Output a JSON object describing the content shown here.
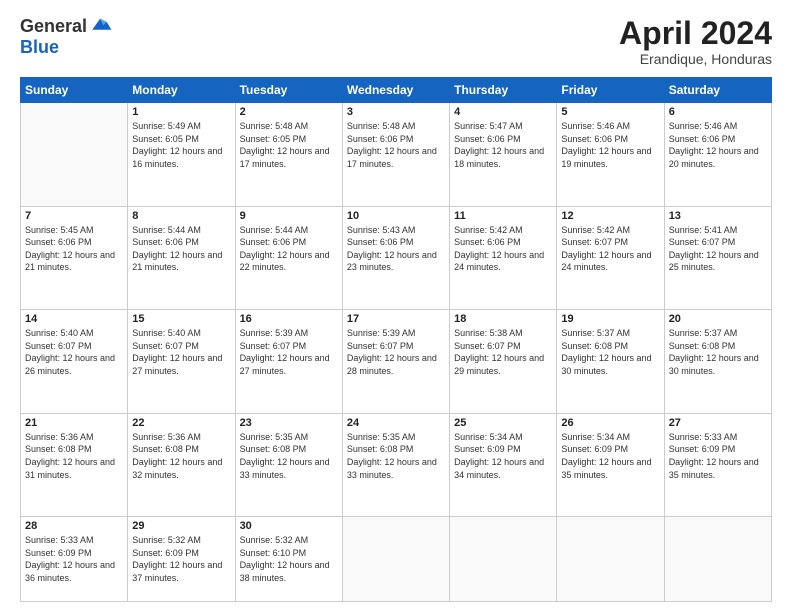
{
  "header": {
    "logo_general": "General",
    "logo_blue": "Blue",
    "month_title": "April 2024",
    "location": "Erandique, Honduras"
  },
  "weekdays": [
    "Sunday",
    "Monday",
    "Tuesday",
    "Wednesday",
    "Thursday",
    "Friday",
    "Saturday"
  ],
  "weeks": [
    [
      {
        "day": "",
        "sunrise": "",
        "sunset": "",
        "daylight": ""
      },
      {
        "day": "1",
        "sunrise": "Sunrise: 5:49 AM",
        "sunset": "Sunset: 6:05 PM",
        "daylight": "Daylight: 12 hours and 16 minutes."
      },
      {
        "day": "2",
        "sunrise": "Sunrise: 5:48 AM",
        "sunset": "Sunset: 6:05 PM",
        "daylight": "Daylight: 12 hours and 17 minutes."
      },
      {
        "day": "3",
        "sunrise": "Sunrise: 5:48 AM",
        "sunset": "Sunset: 6:06 PM",
        "daylight": "Daylight: 12 hours and 17 minutes."
      },
      {
        "day": "4",
        "sunrise": "Sunrise: 5:47 AM",
        "sunset": "Sunset: 6:06 PM",
        "daylight": "Daylight: 12 hours and 18 minutes."
      },
      {
        "day": "5",
        "sunrise": "Sunrise: 5:46 AM",
        "sunset": "Sunset: 6:06 PM",
        "daylight": "Daylight: 12 hours and 19 minutes."
      },
      {
        "day": "6",
        "sunrise": "Sunrise: 5:46 AM",
        "sunset": "Sunset: 6:06 PM",
        "daylight": "Daylight: 12 hours and 20 minutes."
      }
    ],
    [
      {
        "day": "7",
        "sunrise": "Sunrise: 5:45 AM",
        "sunset": "Sunset: 6:06 PM",
        "daylight": "Daylight: 12 hours and 21 minutes."
      },
      {
        "day": "8",
        "sunrise": "Sunrise: 5:44 AM",
        "sunset": "Sunset: 6:06 PM",
        "daylight": "Daylight: 12 hours and 21 minutes."
      },
      {
        "day": "9",
        "sunrise": "Sunrise: 5:44 AM",
        "sunset": "Sunset: 6:06 PM",
        "daylight": "Daylight: 12 hours and 22 minutes."
      },
      {
        "day": "10",
        "sunrise": "Sunrise: 5:43 AM",
        "sunset": "Sunset: 6:06 PM",
        "daylight": "Daylight: 12 hours and 23 minutes."
      },
      {
        "day": "11",
        "sunrise": "Sunrise: 5:42 AM",
        "sunset": "Sunset: 6:06 PM",
        "daylight": "Daylight: 12 hours and 24 minutes."
      },
      {
        "day": "12",
        "sunrise": "Sunrise: 5:42 AM",
        "sunset": "Sunset: 6:07 PM",
        "daylight": "Daylight: 12 hours and 24 minutes."
      },
      {
        "day": "13",
        "sunrise": "Sunrise: 5:41 AM",
        "sunset": "Sunset: 6:07 PM",
        "daylight": "Daylight: 12 hours and 25 minutes."
      }
    ],
    [
      {
        "day": "14",
        "sunrise": "Sunrise: 5:40 AM",
        "sunset": "Sunset: 6:07 PM",
        "daylight": "Daylight: 12 hours and 26 minutes."
      },
      {
        "day": "15",
        "sunrise": "Sunrise: 5:40 AM",
        "sunset": "Sunset: 6:07 PM",
        "daylight": "Daylight: 12 hours and 27 minutes."
      },
      {
        "day": "16",
        "sunrise": "Sunrise: 5:39 AM",
        "sunset": "Sunset: 6:07 PM",
        "daylight": "Daylight: 12 hours and 27 minutes."
      },
      {
        "day": "17",
        "sunrise": "Sunrise: 5:39 AM",
        "sunset": "Sunset: 6:07 PM",
        "daylight": "Daylight: 12 hours and 28 minutes."
      },
      {
        "day": "18",
        "sunrise": "Sunrise: 5:38 AM",
        "sunset": "Sunset: 6:07 PM",
        "daylight": "Daylight: 12 hours and 29 minutes."
      },
      {
        "day": "19",
        "sunrise": "Sunrise: 5:37 AM",
        "sunset": "Sunset: 6:08 PM",
        "daylight": "Daylight: 12 hours and 30 minutes."
      },
      {
        "day": "20",
        "sunrise": "Sunrise: 5:37 AM",
        "sunset": "Sunset: 6:08 PM",
        "daylight": "Daylight: 12 hours and 30 minutes."
      }
    ],
    [
      {
        "day": "21",
        "sunrise": "Sunrise: 5:36 AM",
        "sunset": "Sunset: 6:08 PM",
        "daylight": "Daylight: 12 hours and 31 minutes."
      },
      {
        "day": "22",
        "sunrise": "Sunrise: 5:36 AM",
        "sunset": "Sunset: 6:08 PM",
        "daylight": "Daylight: 12 hours and 32 minutes."
      },
      {
        "day": "23",
        "sunrise": "Sunrise: 5:35 AM",
        "sunset": "Sunset: 6:08 PM",
        "daylight": "Daylight: 12 hours and 33 minutes."
      },
      {
        "day": "24",
        "sunrise": "Sunrise: 5:35 AM",
        "sunset": "Sunset: 6:08 PM",
        "daylight": "Daylight: 12 hours and 33 minutes."
      },
      {
        "day": "25",
        "sunrise": "Sunrise: 5:34 AM",
        "sunset": "Sunset: 6:09 PM",
        "daylight": "Daylight: 12 hours and 34 minutes."
      },
      {
        "day": "26",
        "sunrise": "Sunrise: 5:34 AM",
        "sunset": "Sunset: 6:09 PM",
        "daylight": "Daylight: 12 hours and 35 minutes."
      },
      {
        "day": "27",
        "sunrise": "Sunrise: 5:33 AM",
        "sunset": "Sunset: 6:09 PM",
        "daylight": "Daylight: 12 hours and 35 minutes."
      }
    ],
    [
      {
        "day": "28",
        "sunrise": "Sunrise: 5:33 AM",
        "sunset": "Sunset: 6:09 PM",
        "daylight": "Daylight: 12 hours and 36 minutes."
      },
      {
        "day": "29",
        "sunrise": "Sunrise: 5:32 AM",
        "sunset": "Sunset: 6:09 PM",
        "daylight": "Daylight: 12 hours and 37 minutes."
      },
      {
        "day": "30",
        "sunrise": "Sunrise: 5:32 AM",
        "sunset": "Sunset: 6:10 PM",
        "daylight": "Daylight: 12 hours and 38 minutes."
      },
      {
        "day": "",
        "sunrise": "",
        "sunset": "",
        "daylight": ""
      },
      {
        "day": "",
        "sunrise": "",
        "sunset": "",
        "daylight": ""
      },
      {
        "day": "",
        "sunrise": "",
        "sunset": "",
        "daylight": ""
      },
      {
        "day": "",
        "sunrise": "",
        "sunset": "",
        "daylight": ""
      }
    ]
  ]
}
